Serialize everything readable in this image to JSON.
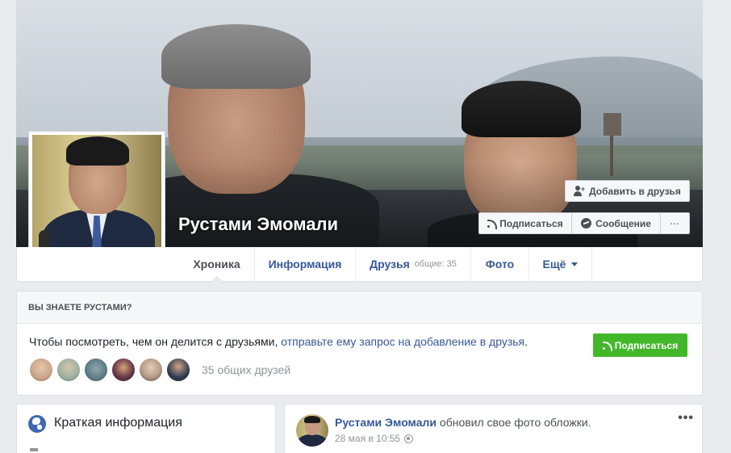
{
  "profile": {
    "name": "Рустами Эмомали"
  },
  "cover_actions": {
    "add_friend": "Добавить в друзья",
    "subscribe": "Подписаться",
    "message": "Сообщение",
    "more": "···"
  },
  "tabs": [
    {
      "label": "Хроника",
      "active": true
    },
    {
      "label": "Информация"
    },
    {
      "label": "Друзья",
      "extra": "общие: 35"
    },
    {
      "label": "Фото"
    },
    {
      "label": "Ещё",
      "dropdown": true
    }
  ],
  "know_card": {
    "heading": "ВЫ ЗНАЕТЕ РУСТАМИ?",
    "text_before": "Чтобы посмотреть, чем он делится с друзьями, ",
    "link_text": "отправьте ему запрос на добавление в друзья",
    "text_after": ".",
    "button": "Подписаться",
    "mutual_friends": "35 общих друзей"
  },
  "intro": {
    "title": "Краткая информация"
  },
  "post": {
    "author": "Рустами Эмомали",
    "action": " обновил свое фото обложки.",
    "date": "28 мая в 10:55",
    "menu": "•••"
  },
  "colors": {
    "link": "#365899",
    "green": "#42b72a",
    "page_bg": "#e9ebee"
  },
  "friend_avatar_colors": [
    "#c9a58a",
    "#9bb0a0",
    "#5d7a86",
    "#3a2e4a",
    "#b59b88",
    "#2f3b52"
  ]
}
